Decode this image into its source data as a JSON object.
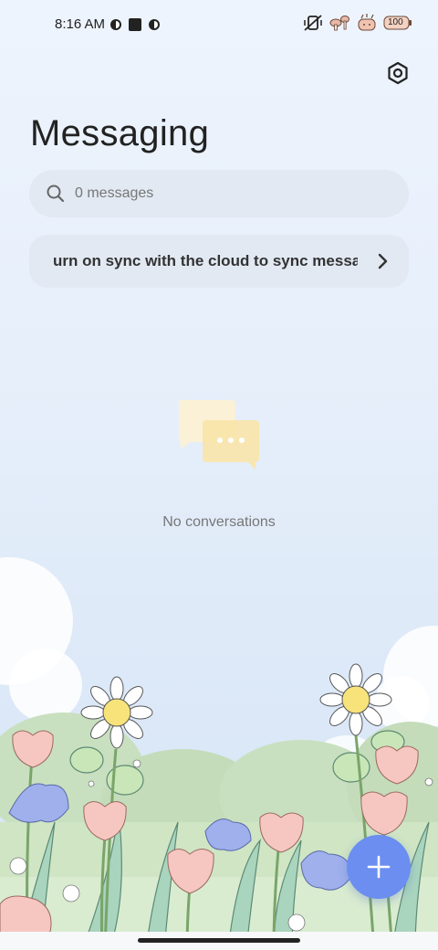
{
  "status_bar": {
    "time": "8:16 AM",
    "battery": "100"
  },
  "header": {
    "title": "Messaging",
    "settings_icon": "settings-gear-icon"
  },
  "search": {
    "placeholder": "0 messages",
    "icon": "search-icon"
  },
  "sync_banner": {
    "text": "urn on sync with the cloud to sync messag",
    "icon": "chevron-right-icon"
  },
  "empty_state": {
    "icon": "chat-bubbles-icon",
    "text": "No conversations"
  },
  "fab": {
    "icon": "plus-icon"
  },
  "colors": {
    "accent": "#6b8ef0",
    "surface": "#e2e9f3",
    "text": "#222222",
    "muted": "#777777"
  }
}
